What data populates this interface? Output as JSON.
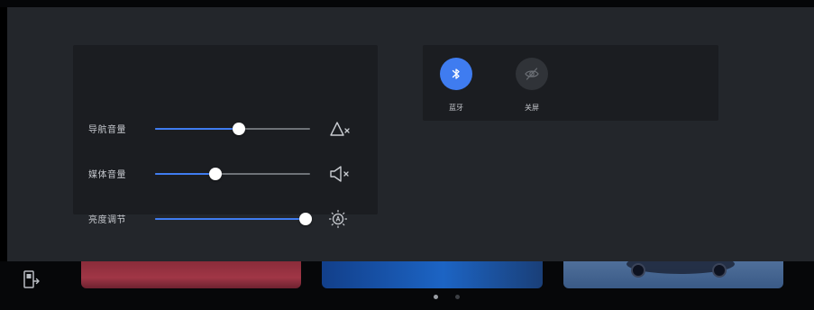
{
  "control_panel": {
    "sliders": [
      {
        "id": "nav",
        "label": "导航音量",
        "value_percent": 54,
        "icon": "navigation-mute-icon"
      },
      {
        "id": "media",
        "label": "媒体音量",
        "value_percent": 39,
        "icon": "speaker-mute-icon"
      },
      {
        "id": "brightness",
        "label": "亮度调节",
        "value_percent": 97,
        "icon": "auto-brightness-icon"
      }
    ],
    "quick_actions": [
      {
        "id": "bluetooth",
        "label": "蓝牙",
        "active": true,
        "icon": "bluetooth-icon"
      },
      {
        "id": "screen_off",
        "label": "关屏",
        "active": false,
        "icon": "eye-off-icon"
      }
    ]
  },
  "pager": {
    "total": 2,
    "current": 1
  },
  "colors": {
    "accent": "#3f7cf0",
    "panel": "#1b1d21",
    "overlay": "#23262b",
    "inactive_button": "#303338"
  }
}
